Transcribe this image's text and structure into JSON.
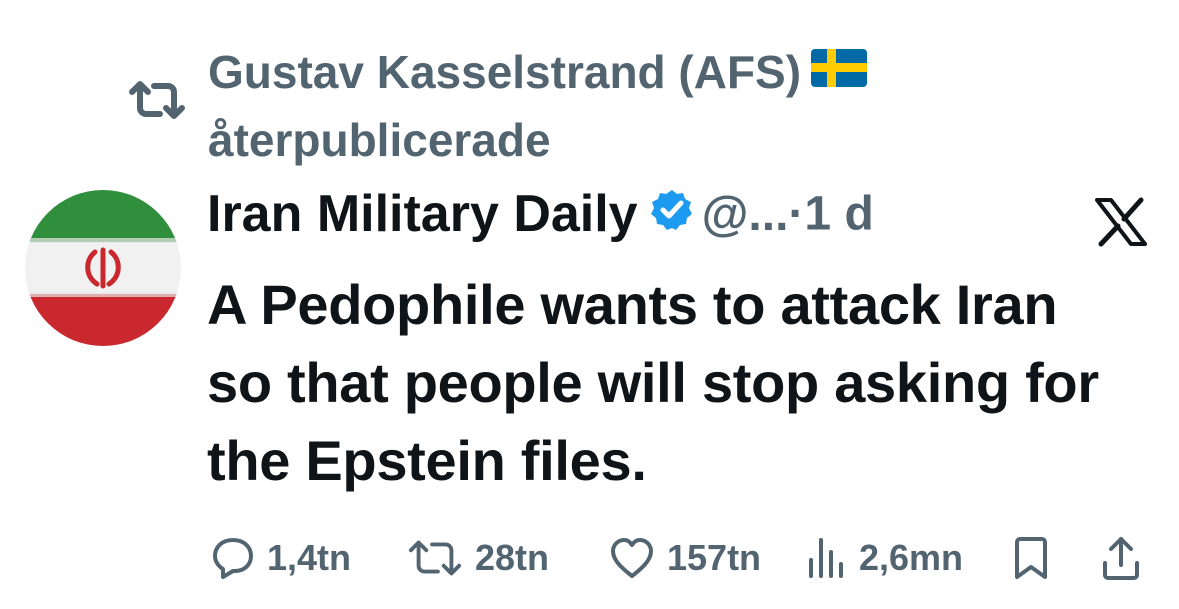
{
  "retweet": {
    "user": "Gustav Kasselstrand (AFS)",
    "action": "återpublicerade",
    "flag_icon": "sweden-flag-icon"
  },
  "tweet": {
    "display_name": "Iran Military Daily",
    "handle": "@...",
    "separator": "·",
    "time": "1 d",
    "verified_icon": "verified-badge-icon",
    "platform_icon": "x-logo-icon",
    "avatar_icon": "iran-flag-avatar",
    "text": "A Pedophile wants to attack Iran so that people will stop asking for the Epstein files."
  },
  "actions": {
    "replies": "1,4tn",
    "reposts": "28tn",
    "likes": "157tn",
    "views": "2,6mn"
  },
  "colors": {
    "secondary_text": "#536471",
    "primary_text": "#0f1419",
    "verified_blue": "#1d9bf0"
  }
}
